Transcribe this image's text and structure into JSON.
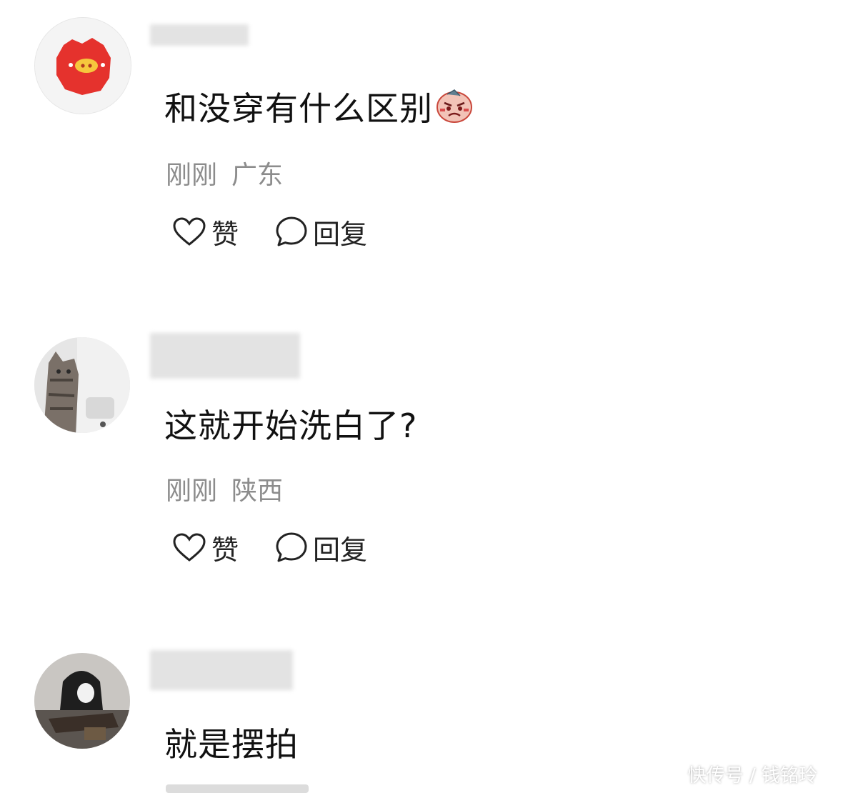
{
  "comments": [
    {
      "avatar_icon": "pig-avatar-icon",
      "text": "和没穿有什么区别",
      "emoji_icon": "angry-face-emoji-icon",
      "time": "刚刚",
      "location": "广东",
      "like_label": "赞",
      "reply_label": "回复"
    },
    {
      "avatar_icon": "cat-photo-avatar",
      "text": "这就开始洗白了?",
      "time": "刚刚",
      "location": "陕西",
      "like_label": "赞",
      "reply_label": "回复"
    },
    {
      "avatar_icon": "person-photo-avatar",
      "text": "就是摆拍"
    }
  ],
  "watermark": "快传号 / 钱铭玲",
  "colors": {
    "background": "#ffffff",
    "text": "#111111",
    "meta": "#8c8c8c",
    "avatar_red": "#e5322d"
  }
}
